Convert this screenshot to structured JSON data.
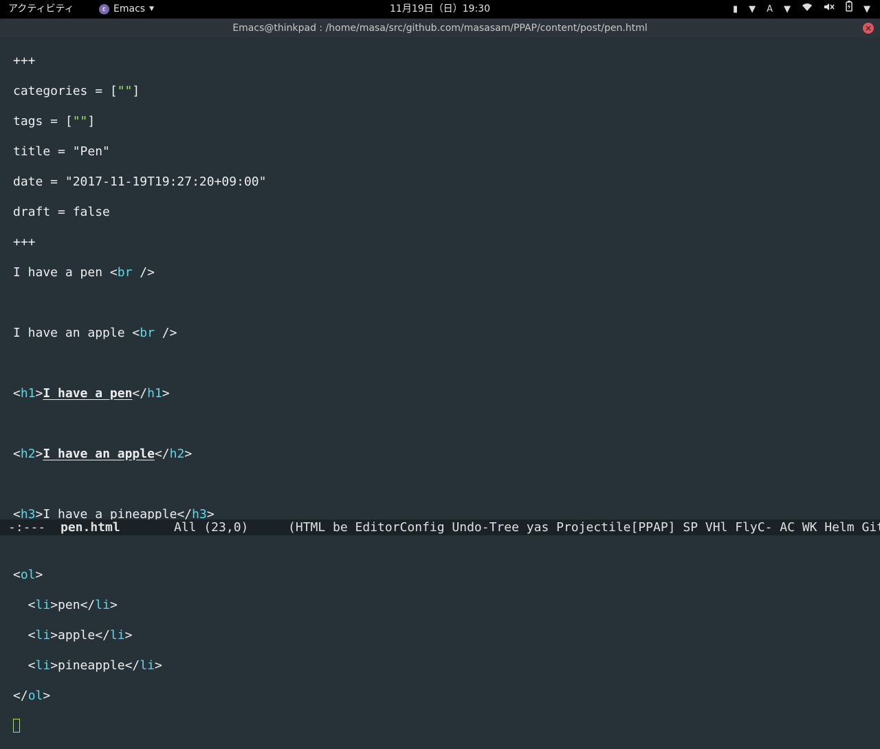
{
  "topbar": {
    "activities": "アクティビティ",
    "app_name": "Emacs",
    "clock": "11月19日（日）19:30",
    "input_method": "A"
  },
  "window": {
    "title": "Emacs@thinkpad : /home/masa/src/github.com/masasam/PPAP/content/post/pen.html"
  },
  "buffer": {
    "front_matter": {
      "open": "+++",
      "categories_key": "categories = [",
      "categories_val": "\"\"",
      "categories_end": "]",
      "tags_key": "tags = [",
      "tags_val": "\"\"",
      "tags_end": "]",
      "title_line": "title = \"Pen\"",
      "date_line": "date = \"2017-11-19T19:27:20+09:00\"",
      "draft_line": "draft = false",
      "close": "+++"
    },
    "line_pen": "I have a pen ",
    "line_apple": "I have an apple ",
    "br_tag": "br",
    "h1_tag": "h1",
    "h1_text": "I have a pen",
    "h2_tag": "h2",
    "h2_text": "I have an apple",
    "h3_tag": "h3",
    "h3_text": "I have a pineapple",
    "ol_tag": "ol",
    "li_tag": "li",
    "items": [
      "pen",
      "apple",
      "pineapple"
    ]
  },
  "modeline": {
    "status": "-:---",
    "buffer_name": "pen.html",
    "position": "All (23,0)",
    "modes": "(HTML be EditorConfig Undo-Tree yas Projectile[PPAP] SP VHl FlyC- AC WK Helm Git"
  },
  "colors": {
    "background": "#263238",
    "tag": "#63d6e6",
    "string": "#9de36c",
    "cursor": "#9de36c"
  }
}
